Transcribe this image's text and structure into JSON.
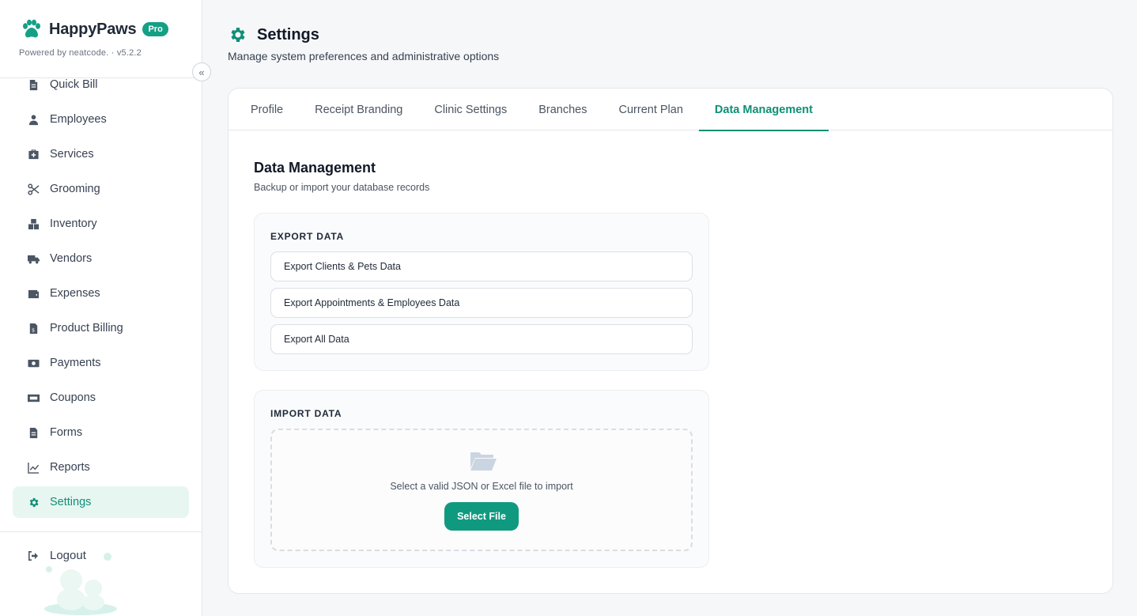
{
  "sidebar": {
    "brand_name": "HappyPaws",
    "badge": "Pro",
    "powered_by": "Powered by neatcode. · v5.2.2",
    "items": [
      {
        "label": "Quick Bill",
        "icon": "document-icon"
      },
      {
        "label": "Employees",
        "icon": "user-icon"
      },
      {
        "label": "Services",
        "icon": "medical-kit-icon"
      },
      {
        "label": "Grooming",
        "icon": "scissors-icon"
      },
      {
        "label": "Inventory",
        "icon": "boxes-icon"
      },
      {
        "label": "Vendors",
        "icon": "truck-icon"
      },
      {
        "label": "Expenses",
        "icon": "wallet-icon"
      },
      {
        "label": "Product Billing",
        "icon": "invoice-icon"
      },
      {
        "label": "Payments",
        "icon": "money-icon"
      },
      {
        "label": "Coupons",
        "icon": "ticket-icon"
      },
      {
        "label": "Forms",
        "icon": "form-icon"
      },
      {
        "label": "Reports",
        "icon": "chart-line-icon"
      },
      {
        "label": "Settings",
        "icon": "gear-icon",
        "active": true
      }
    ],
    "logout": "Logout"
  },
  "page": {
    "title": "Settings",
    "subtitle": "Manage system preferences and administrative options"
  },
  "tabs": [
    {
      "label": "Profile"
    },
    {
      "label": "Receipt Branding"
    },
    {
      "label": "Clinic Settings"
    },
    {
      "label": "Branches"
    },
    {
      "label": "Current Plan"
    },
    {
      "label": "Data Management",
      "active": true
    }
  ],
  "data_management": {
    "title": "Data Management",
    "subtitle": "Backup or import your database records",
    "export": {
      "label": "EXPORT DATA",
      "buttons": [
        "Export Clients & Pets Data",
        "Export Appointments & Employees Data",
        "Export All Data"
      ]
    },
    "import": {
      "label": "IMPORT DATA",
      "hint": "Select a valid JSON or Excel file to import",
      "button": "Select File"
    }
  },
  "colors": {
    "accent": "#0f8f76",
    "accent_button": "#0f9a80",
    "active_bg": "#e8f6f2"
  }
}
